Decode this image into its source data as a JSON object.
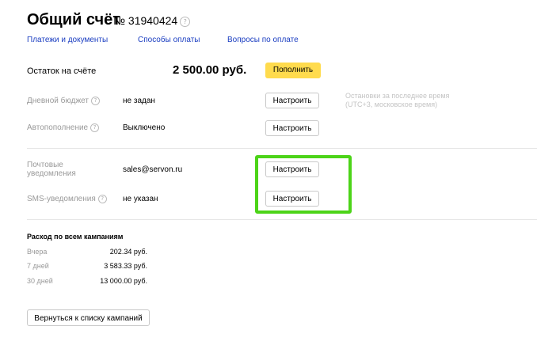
{
  "header": {
    "title": "Общий счёт",
    "account_number": "№ 31940424",
    "help_icon": "?"
  },
  "links": [
    {
      "label": "Платежи и документы"
    },
    {
      "label": "Способы оплаты"
    },
    {
      "label": "Вопросы по оплате"
    }
  ],
  "balance": {
    "label": "Остаток на счёте",
    "amount": "2 500.00 руб.",
    "topup_button": "Пополнить"
  },
  "settings": {
    "daily_budget": {
      "label": "Дневной бюджет",
      "value": "не задан",
      "button": "Настроить"
    },
    "autopay": {
      "label": "Автопополнение",
      "value": "Выключено",
      "button": "Настроить"
    },
    "note": [
      "Остановки за последнее время",
      "(UTC+3, московское время)"
    ]
  },
  "notifications": {
    "email": {
      "label_line1": "Почтовые",
      "label_line2": "уведомления",
      "value": "sales@servon.ru",
      "button": "Настроить"
    },
    "sms": {
      "label": "SMS-уведомления",
      "value": "не указан",
      "button": "Настроить"
    }
  },
  "spending": {
    "title": "Расход по всем кампаниям",
    "rows": [
      {
        "label": "Вчера",
        "value": "202.34 руб."
      },
      {
        "label": "7 дней",
        "value": "3 583.33 руб."
      },
      {
        "label": "30 дней",
        "value": "13 000.00 руб."
      }
    ]
  },
  "back_button": "Вернуться к списку кампаний",
  "colors": {
    "accent_yellow": "#ffdb4d",
    "link_blue": "#1a3dc1",
    "highlight_green": "#4cd418"
  }
}
